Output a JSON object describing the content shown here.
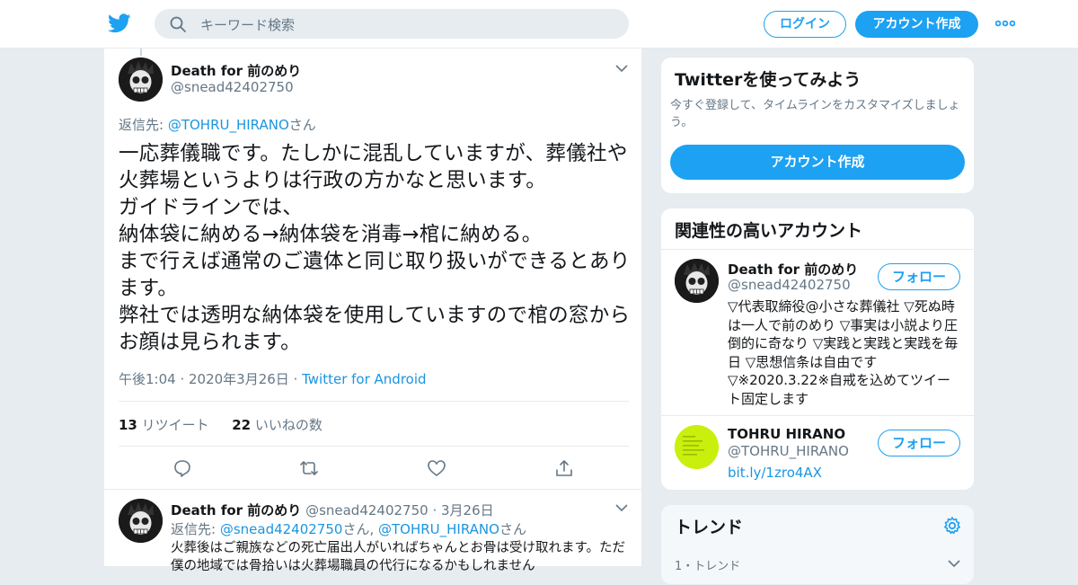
{
  "header": {
    "search_placeholder": "キーワード検索",
    "login_label": "ログイン",
    "signup_label": "アカウント作成"
  },
  "tweet": {
    "author_name": "Death for 前のめり",
    "author_handle": "@snead42402750",
    "reply_to_label": "返信先: ",
    "reply_to_user": "@TOHRU_HIRANO",
    "reply_to_suffix": "さん",
    "text": "一応葬儀職です。たしかに混乱していますが、葬儀社や火葬場というよりは行政の方かなと思います。\nガイドラインでは、\n納体袋に納める→納体袋を消毒→棺に納める。\nまで行えば通常のご遺体と同じ取り扱いができるとあります。\n弊社では透明な納体袋を使用していますので棺の窓からお顔は見られます。",
    "timestamp": "午後1:04 · 2020年3月26日",
    "separator": " · ",
    "source": "Twitter for Android",
    "retweets_count": "13",
    "retweets_label": "リツイート",
    "likes_count": "22",
    "likes_label": "いいねの数"
  },
  "reply": {
    "author_name": "Death for 前のめり",
    "author_handle": "@snead42402750",
    "date": "· 3月26日",
    "reply_to_label": "返信先: ",
    "reply_to_user1": "@snead42402750",
    "reply_to_mid": "さん, ",
    "reply_to_user2": "@TOHRU_HIRANO",
    "reply_to_suffix": "さん",
    "text": "火葬後はご親族などの死亡届出人がいればちゃんとお骨は受け取れます。ただ僕の地域では骨拾いは火葬場職員の代行になるかもしれません"
  },
  "promo": {
    "title": "Twitterを使ってみよう",
    "text": "今すぐ登録して、タイムラインをカスタマイズしましょう。",
    "button_label": "アカウント作成"
  },
  "related": {
    "title": "関連性の高いアカウント",
    "accounts": [
      {
        "name": "Death for 前のめり",
        "handle": "@snead42402750",
        "follow_label": "フォロー",
        "bio": "▽代表取締役@小さな葬儀社 ▽死ぬ時は一人で前のめり ▽事実は小説より圧倒的に奇なり ▽実践と実践と実践を毎日 ▽思想信条は自由です ▽※2020.3.22※自戒を込めてツイート固定します"
      },
      {
        "name": "TOHRU HIRANO",
        "handle": "@TOHRU_HIRANO",
        "follow_label": "フォロー",
        "link": "bit.ly/1zro4AX"
      }
    ]
  },
  "trends": {
    "title": "トレンド",
    "first_sub": "1・トレンド"
  },
  "colors": {
    "accent": "#1da1f2",
    "link": "#1b95e0",
    "muted": "#657786",
    "background": "#e6ecf0"
  }
}
